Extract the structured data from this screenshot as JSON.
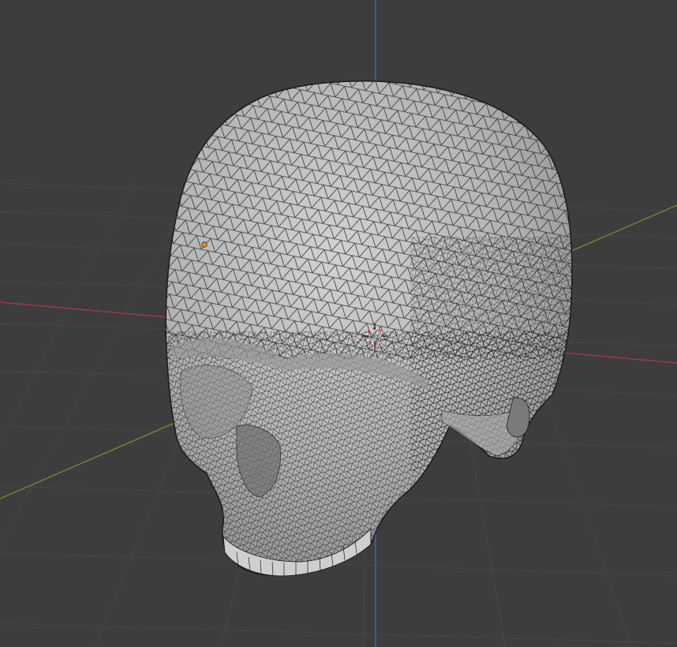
{
  "viewport": {
    "background": "#3d3d3d",
    "grid_color": "#4a4a4a",
    "x_axis_color": "#9c3b45",
    "y_axis_color": "#6c8a35",
    "z_axis_color": "#3b6db3"
  },
  "mesh": {
    "object_icon": "skull-mesh",
    "fill_color": "#b9b9b9",
    "wire_color": "#202020",
    "display": "wireframe-overlay"
  },
  "origin_point": {
    "icon": "object-origin-dot",
    "color": "#e8902a"
  },
  "cursor_3d": {
    "icon": "3d-cursor-icon",
    "color_a": "#d8d8d8",
    "color_b": "#c23a3a"
  }
}
